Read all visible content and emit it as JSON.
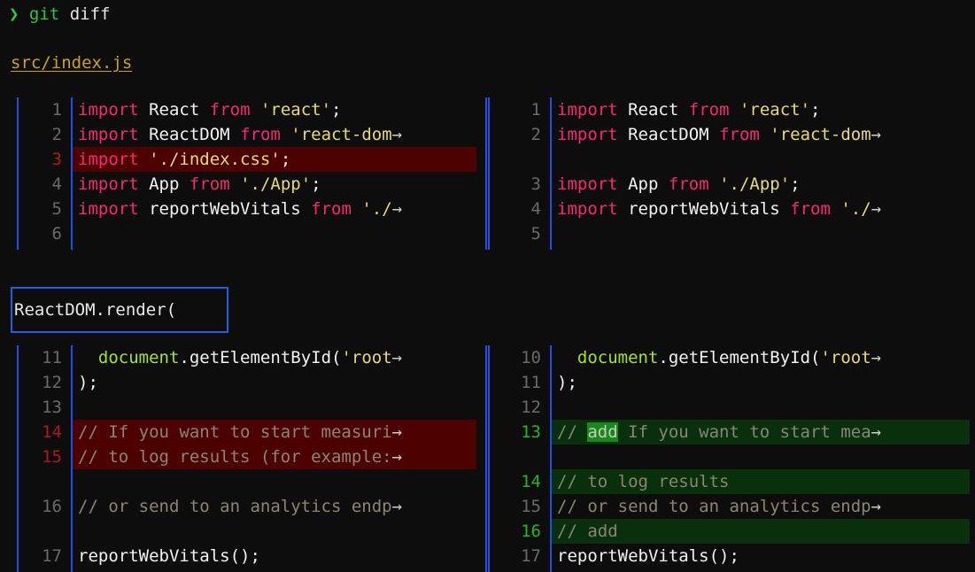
{
  "terminal": {
    "prompt_symbol": "❯",
    "command": "git",
    "argument": "diff"
  },
  "file": {
    "path": "src/index.js"
  },
  "hunk_header": {
    "text": "ReactDOM.render("
  },
  "colors": {
    "background": "#0d0d0d",
    "accent_rule": "#1f4fe8",
    "deleted_line_bg": "#4d0202",
    "added_line_bg": "#07300b",
    "added_word_bg": "#18871c",
    "deleted_lineno": "#b01818",
    "added_lineno": "#22b722",
    "keyword": "#f92672",
    "string": "#e6db74",
    "function": "#a6e22e",
    "comment": "#8a8574",
    "filename": "#c9a227"
  },
  "overflow_marker": "→",
  "blocks": [
    {
      "id": "block-a",
      "side": "left",
      "lines": [
        {
          "no": "1",
          "status": "context",
          "tokens": [
            {
              "t": "import",
              "c": "kw"
            },
            {
              "t": " ",
              "c": "plain"
            },
            {
              "t": "React",
              "c": "id"
            },
            {
              "t": " ",
              "c": "plain"
            },
            {
              "t": "from",
              "c": "kw"
            },
            {
              "t": " ",
              "c": "plain"
            },
            {
              "t": "'react'",
              "c": "str"
            },
            {
              "t": ";",
              "c": "punc"
            }
          ]
        },
        {
          "no": "2",
          "status": "context",
          "tokens": [
            {
              "t": "import",
              "c": "kw"
            },
            {
              "t": " ",
              "c": "plain"
            },
            {
              "t": "ReactDOM",
              "c": "id"
            },
            {
              "t": " ",
              "c": "plain"
            },
            {
              "t": "from",
              "c": "kw"
            },
            {
              "t": " ",
              "c": "plain"
            },
            {
              "t": "'react-dom",
              "c": "str"
            },
            {
              "t": "→",
              "c": "ovf"
            }
          ]
        },
        {
          "no": "3",
          "status": "deleted",
          "tokens": [
            {
              "t": "import",
              "c": "kw"
            },
            {
              "t": " ",
              "c": "plain"
            },
            {
              "t": "'./index.css'",
              "c": "str"
            },
            {
              "t": ";",
              "c": "punc"
            }
          ]
        },
        {
          "no": "4",
          "status": "context",
          "tokens": [
            {
              "t": "import",
              "c": "kw"
            },
            {
              "t": " ",
              "c": "plain"
            },
            {
              "t": "App",
              "c": "id"
            },
            {
              "t": " ",
              "c": "plain"
            },
            {
              "t": "from",
              "c": "kw"
            },
            {
              "t": " ",
              "c": "plain"
            },
            {
              "t": "'./App'",
              "c": "str"
            },
            {
              "t": ";",
              "c": "punc"
            }
          ]
        },
        {
          "no": "5",
          "status": "context",
          "tokens": [
            {
              "t": "import",
              "c": "kw"
            },
            {
              "t": " ",
              "c": "plain"
            },
            {
              "t": "reportWebVitals",
              "c": "id"
            },
            {
              "t": " ",
              "c": "plain"
            },
            {
              "t": "from",
              "c": "kw"
            },
            {
              "t": " ",
              "c": "plain"
            },
            {
              "t": "'./",
              "c": "str"
            },
            {
              "t": "→",
              "c": "ovf"
            }
          ]
        },
        {
          "no": "6",
          "status": "context",
          "tokens": []
        }
      ]
    },
    {
      "id": "block-b",
      "side": "right",
      "lines": [
        {
          "no": "1",
          "status": "context",
          "tokens": [
            {
              "t": "import",
              "c": "kw"
            },
            {
              "t": " ",
              "c": "plain"
            },
            {
              "t": "React",
              "c": "id"
            },
            {
              "t": " ",
              "c": "plain"
            },
            {
              "t": "from",
              "c": "kw"
            },
            {
              "t": " ",
              "c": "plain"
            },
            {
              "t": "'react'",
              "c": "str"
            },
            {
              "t": ";",
              "c": "punc"
            }
          ]
        },
        {
          "no": "2",
          "status": "context",
          "tokens": [
            {
              "t": "import",
              "c": "kw"
            },
            {
              "t": " ",
              "c": "plain"
            },
            {
              "t": "ReactDOM",
              "c": "id"
            },
            {
              "t": " ",
              "c": "plain"
            },
            {
              "t": "from",
              "c": "kw"
            },
            {
              "t": " ",
              "c": "plain"
            },
            {
              "t": "'react-dom",
              "c": "str"
            },
            {
              "t": "→",
              "c": "ovf"
            }
          ]
        },
        {
          "no": "",
          "status": "filler",
          "tokens": []
        },
        {
          "no": "3",
          "status": "context",
          "tokens": [
            {
              "t": "import",
              "c": "kw"
            },
            {
              "t": " ",
              "c": "plain"
            },
            {
              "t": "App",
              "c": "id"
            },
            {
              "t": " ",
              "c": "plain"
            },
            {
              "t": "from",
              "c": "kw"
            },
            {
              "t": " ",
              "c": "plain"
            },
            {
              "t": "'./App'",
              "c": "str"
            },
            {
              "t": ";",
              "c": "punc"
            }
          ]
        },
        {
          "no": "4",
          "status": "context",
          "tokens": [
            {
              "t": "import",
              "c": "kw"
            },
            {
              "t": " ",
              "c": "plain"
            },
            {
              "t": "reportWebVitals",
              "c": "id"
            },
            {
              "t": " ",
              "c": "plain"
            },
            {
              "t": "from",
              "c": "kw"
            },
            {
              "t": " ",
              "c": "plain"
            },
            {
              "t": "'./",
              "c": "str"
            },
            {
              "t": "→",
              "c": "ovf"
            }
          ]
        },
        {
          "no": "5",
          "status": "context",
          "tokens": []
        }
      ]
    },
    {
      "id": "block-c",
      "side": "left",
      "lines": [
        {
          "no": "11",
          "status": "context",
          "tokens": [
            {
              "t": "  ",
              "c": "plain"
            },
            {
              "t": "document",
              "c": "fn"
            },
            {
              "t": ".",
              "c": "punc"
            },
            {
              "t": "getElementById",
              "c": "plain"
            },
            {
              "t": "(",
              "c": "punc"
            },
            {
              "t": "'root",
              "c": "str"
            },
            {
              "t": "→",
              "c": "ovf"
            }
          ]
        },
        {
          "no": "12",
          "status": "context",
          "tokens": [
            {
              "t": ");",
              "c": "plain"
            }
          ]
        },
        {
          "no": "13",
          "status": "context",
          "tokens": []
        },
        {
          "no": "14",
          "status": "deleted",
          "tokens": [
            {
              "t": "// If you want to start measuri",
              "c": "cmt"
            },
            {
              "t": "→",
              "c": "ovf"
            }
          ]
        },
        {
          "no": "15",
          "status": "deleted",
          "tokens": [
            {
              "t": "// to log results (for example:",
              "c": "cmt"
            },
            {
              "t": "→",
              "c": "ovf"
            }
          ]
        },
        {
          "no": "",
          "status": "filler",
          "tokens": []
        },
        {
          "no": "16",
          "status": "context",
          "tokens": [
            {
              "t": "// or send to an analytics endp",
              "c": "cmt"
            },
            {
              "t": "→",
              "c": "ovf"
            }
          ]
        },
        {
          "no": "",
          "status": "filler",
          "tokens": []
        },
        {
          "no": "17",
          "status": "context",
          "tokens": [
            {
              "t": "reportWebVitals();",
              "c": "plain"
            }
          ]
        }
      ]
    },
    {
      "id": "block-d",
      "side": "right",
      "lines": [
        {
          "no": "10",
          "status": "context",
          "tokens": [
            {
              "t": "  ",
              "c": "plain"
            },
            {
              "t": "document",
              "c": "fn"
            },
            {
              "t": ".",
              "c": "punc"
            },
            {
              "t": "getElementById",
              "c": "plain"
            },
            {
              "t": "(",
              "c": "punc"
            },
            {
              "t": "'root",
              "c": "str"
            },
            {
              "t": "→",
              "c": "ovf"
            }
          ]
        },
        {
          "no": "11",
          "status": "context",
          "tokens": [
            {
              "t": ");",
              "c": "plain"
            }
          ]
        },
        {
          "no": "12",
          "status": "context",
          "tokens": []
        },
        {
          "no": "13",
          "status": "added",
          "tokens": [
            {
              "t": "// ",
              "c": "cmt"
            },
            {
              "t": "add",
              "c": "wordadd"
            },
            {
              "t": " If you want to start mea",
              "c": "cmt"
            },
            {
              "t": "→",
              "c": "ovf"
            }
          ]
        },
        {
          "no": "",
          "status": "filler",
          "tokens": []
        },
        {
          "no": "14",
          "status": "added",
          "tokens": [
            {
              "t": "// to log results",
              "c": "cmt"
            }
          ]
        },
        {
          "no": "15",
          "status": "context",
          "tokens": [
            {
              "t": "// or send to an analytics endp",
              "c": "cmt"
            },
            {
              "t": "→",
              "c": "ovf"
            }
          ]
        },
        {
          "no": "16",
          "status": "added",
          "tokens": [
            {
              "t": "// add",
              "c": "cmt"
            }
          ]
        },
        {
          "no": "17",
          "status": "context",
          "tokens": [
            {
              "t": "reportWebVitals();",
              "c": "plain"
            }
          ]
        }
      ]
    }
  ]
}
